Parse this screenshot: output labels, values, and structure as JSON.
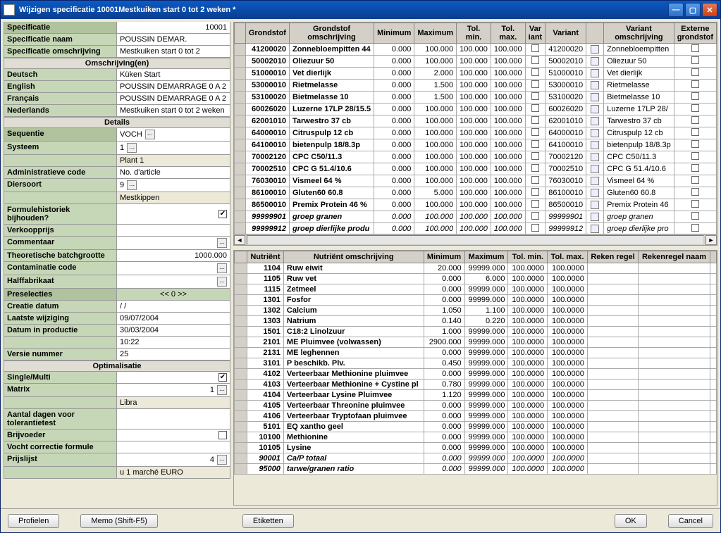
{
  "title": "Wijzigen specificatie       10001Mestkuiken start 0 tot 2 weken       *",
  "left": {
    "spec": {
      "specificatie_l": "Specificatie",
      "specificatie_v": "10001",
      "specnaam_l": "Specificatie naam",
      "specnaam_v": "POUSSIN DEMAR.",
      "specoms_l": "Specificatie omschrijving",
      "specoms_v": "Mestkuiken start 0 tot 2"
    },
    "oms_hdr": "Omschrijving(en)",
    "langs": [
      {
        "l": "Deutsch",
        "v": "Küken Start"
      },
      {
        "l": "English",
        "v": "POUSSIN DEMARRAGE 0 A 2"
      },
      {
        "l": "Français",
        "v": "POUSSIN DEMARRAGE 0 A 2"
      },
      {
        "l": "Nederlands",
        "v": "Mestkuiken start 0 tot 2 weken"
      }
    ],
    "details_hdr": "Details",
    "seq_l": "Sequentie",
    "seq_v": "VOCH",
    "sys_l": "Systeem",
    "sys_v": "1",
    "sys_v2": "Plant 1",
    "admin_l": "Administratieve code",
    "admin_v": "No. d'article",
    "dier_l": "Diersoort",
    "dier_v": "9",
    "dier_v2": "Mestkippen",
    "hist_l": "Formulehistoriek bijhouden?",
    "verkoop_l": "Verkoopprijs",
    "comm_l": "Commentaar",
    "batch_l": "Theoretische batchgrootte",
    "batch_v": "1000.000",
    "cont_l": "Contaminatie code",
    "half_l": "Halffabrikaat",
    "presel_l": "Preselecties",
    "presel_v": "<<   0   >>",
    "cdat_l": "Creatie datum",
    "cdat_v": "/ /",
    "lwijz_l": "Laatste wijziging",
    "lwijz_v": "09/07/2004",
    "dprod_l": "Datum in productie",
    "dprod_v": "30/03/2004",
    "dprod_v2": "10:22",
    "vers_l": "Versie nummer",
    "vers_v": "25",
    "opt_hdr": "Optimalisatie",
    "sm_l": "Single/Multi",
    "matrix_l": "Matrix",
    "matrix_v": "1",
    "matrix_v2": "Libra",
    "adag_l": "Aantal dagen voor tolerantietest",
    "brij_l": "Brijvoeder",
    "vocht_l": "Vocht correctie formule",
    "prijs_l": "Prijslijst",
    "prijs_v": "4",
    "prijs_v2": "u 1 marché EURO"
  },
  "top_headers": [
    "Grondstof",
    "Grondstof omschrijving",
    "Minimum",
    "Maximum",
    "Tol. min.",
    "Tol. max.",
    "Var iant",
    "Variant",
    "",
    "Variant omschrijving",
    "Externe grondstof"
  ],
  "top_rows": [
    {
      "g": "41200020",
      "o": "Zonnebloempitten 44",
      "mn": "0.000",
      "mx": "100.000",
      "tn": "100.000",
      "tx": "100.000",
      "v": "41200020",
      "vo": "Zonnebloempitten"
    },
    {
      "g": "50002010",
      "o": "Oliezuur 50",
      "mn": "0.000",
      "mx": "100.000",
      "tn": "100.000",
      "tx": "100.000",
      "v": "50002010",
      "vo": "Oliezuur 50"
    },
    {
      "g": "51000010",
      "o": "Vet dierlijk",
      "mn": "0.000",
      "mx": "2.000",
      "tn": "100.000",
      "tx": "100.000",
      "v": "51000010",
      "vo": "Vet dierlijk"
    },
    {
      "g": "53000010",
      "o": "Rietmelasse",
      "mn": "0.000",
      "mx": "1.500",
      "tn": "100.000",
      "tx": "100.000",
      "v": "53000010",
      "vo": "Rietmelasse"
    },
    {
      "g": "53100020",
      "o": "Bietmelasse 10",
      "mn": "0.000",
      "mx": "1.500",
      "tn": "100.000",
      "tx": "100.000",
      "v": "53100020",
      "vo": "Bietmelasse 10"
    },
    {
      "g": "60026020",
      "o": "Luzerne 17LP 28/15.5",
      "mn": "0.000",
      "mx": "100.000",
      "tn": "100.000",
      "tx": "100.000",
      "v": "60026020",
      "vo": "Luzerne 17LP 28/"
    },
    {
      "g": "62001010",
      "o": "Tarwestro 37 cb",
      "mn": "0.000",
      "mx": "100.000",
      "tn": "100.000",
      "tx": "100.000",
      "v": "62001010",
      "vo": "Tarwestro 37 cb"
    },
    {
      "g": "64000010",
      "o": "Citruspulp 12 cb",
      "mn": "0.000",
      "mx": "100.000",
      "tn": "100.000",
      "tx": "100.000",
      "v": "64000010",
      "vo": "Citruspulp 12 cb"
    },
    {
      "g": "64100010",
      "o": "bietenpulp 18/8.3p",
      "mn": "0.000",
      "mx": "100.000",
      "tn": "100.000",
      "tx": "100.000",
      "v": "64100010",
      "vo": "bietenpulp 18/8.3p"
    },
    {
      "g": "70002120",
      "o": "CPC C50/11.3",
      "mn": "0.000",
      "mx": "100.000",
      "tn": "100.000",
      "tx": "100.000",
      "v": "70002120",
      "vo": "CPC C50/11.3"
    },
    {
      "g": "70002510",
      "o": "CPC G 51.4/10.6",
      "mn": "0.000",
      "mx": "100.000",
      "tn": "100.000",
      "tx": "100.000",
      "v": "70002510",
      "vo": "CPC G 51.4/10.6"
    },
    {
      "g": "76030010",
      "o": "Vismeel 64 %",
      "mn": "0.000",
      "mx": "100.000",
      "tn": "100.000",
      "tx": "100.000",
      "v": "76030010",
      "vo": "Vismeel 64 %"
    },
    {
      "g": "86100010",
      "o": "Gluten60 60.8",
      "mn": "0.000",
      "mx": "5.000",
      "tn": "100.000",
      "tx": "100.000",
      "v": "86100010",
      "vo": "Gluten60 60.8"
    },
    {
      "g": "86500010",
      "o": "Premix Protein 46 %",
      "mn": "0.000",
      "mx": "100.000",
      "tn": "100.000",
      "tx": "100.000",
      "v": "86500010",
      "vo": "Premix Protein 46"
    },
    {
      "g": "99999901",
      "o": "groep granen",
      "mn": "0.000",
      "mx": "100.000",
      "tn": "100.000",
      "tx": "100.000",
      "v": "99999901",
      "vo": "groep granen",
      "it": true
    },
    {
      "g": "99999912",
      "o": "groep dierlijke produ",
      "mn": "0.000",
      "mx": "100.000",
      "tn": "100.000",
      "tx": "100.000",
      "v": "99999912",
      "vo": "groep dierlijke pro",
      "it": true
    }
  ],
  "bot_headers": [
    "Nutriënt",
    "Nutriënt omschrijving",
    "Minimum",
    "Maximum",
    "Tol. min.",
    "Tol. max.",
    "Reken regel",
    "Rekenregel naam",
    ""
  ],
  "bot_rows": [
    {
      "n": "1104",
      "o": "Ruw eiwit",
      "mn": "20.000",
      "mx": "99999.000",
      "tn": "100.0000",
      "tx": "100.0000"
    },
    {
      "n": "1105",
      "o": "Ruw vet",
      "mn": "0.000",
      "mx": "6.000",
      "tn": "100.0000",
      "tx": "100.0000"
    },
    {
      "n": "1115",
      "o": "Zetmeel",
      "mn": "0.000",
      "mx": "99999.000",
      "tn": "100.0000",
      "tx": "100.0000"
    },
    {
      "n": "1301",
      "o": "Fosfor",
      "mn": "0.000",
      "mx": "99999.000",
      "tn": "100.0000",
      "tx": "100.0000"
    },
    {
      "n": "1302",
      "o": "Calcium",
      "mn": "1.050",
      "mx": "1.100",
      "tn": "100.0000",
      "tx": "100.0000"
    },
    {
      "n": "1303",
      "o": "Natrium",
      "mn": "0.140",
      "mx": "0.220",
      "tn": "100.0000",
      "tx": "100.0000"
    },
    {
      "n": "1501",
      "o": "C18:2 Linolzuur",
      "mn": "1.000",
      "mx": "99999.000",
      "tn": "100.0000",
      "tx": "100.0000"
    },
    {
      "n": "2101",
      "o": "ME Pluimvee (volwassen)",
      "mn": "2900.000",
      "mx": "99999.000",
      "tn": "100.0000",
      "tx": "100.0000"
    },
    {
      "n": "2131",
      "o": "ME leghennen",
      "mn": "0.000",
      "mx": "99999.000",
      "tn": "100.0000",
      "tx": "100.0000"
    },
    {
      "n": "3101",
      "o": "P beschikb. Plv.",
      "mn": "0.450",
      "mx": "99999.000",
      "tn": "100.0000",
      "tx": "100.0000"
    },
    {
      "n": "4102",
      "o": "Verteerbaar Methionine pluimvee",
      "mn": "0.000",
      "mx": "99999.000",
      "tn": "100.0000",
      "tx": "100.0000"
    },
    {
      "n": "4103",
      "o": "Verteerbaar Methionine + Cystine pl",
      "mn": "0.780",
      "mx": "99999.000",
      "tn": "100.0000",
      "tx": "100.0000"
    },
    {
      "n": "4104",
      "o": "Verteerbaar Lysine Pluimvee",
      "mn": "1.120",
      "mx": "99999.000",
      "tn": "100.0000",
      "tx": "100.0000"
    },
    {
      "n": "4105",
      "o": "Verteerbaar Threonine pluimvee",
      "mn": "0.000",
      "mx": "99999.000",
      "tn": "100.0000",
      "tx": "100.0000"
    },
    {
      "n": "4106",
      "o": "Verteerbaar Tryptofaan pluimvee",
      "mn": "0.000",
      "mx": "99999.000",
      "tn": "100.0000",
      "tx": "100.0000"
    },
    {
      "n": "5101",
      "o": "EQ xantho geel",
      "mn": "0.000",
      "mx": "99999.000",
      "tn": "100.0000",
      "tx": "100.0000"
    },
    {
      "n": "10100",
      "o": "Methionine",
      "mn": "0.000",
      "mx": "99999.000",
      "tn": "100.0000",
      "tx": "100.0000"
    },
    {
      "n": "10105",
      "o": "Lysine",
      "mn": "0.000",
      "mx": "99999.000",
      "tn": "100.0000",
      "tx": "100.0000"
    },
    {
      "n": "90001",
      "o": "Ca/P totaal",
      "mn": "0.000",
      "mx": "99999.000",
      "tn": "100.0000",
      "tx": "100.0000",
      "it": true
    },
    {
      "n": "95000",
      "o": "tarwe/granen ratio",
      "mn": "0.000",
      "mx": "99999.000",
      "tn": "100.0000",
      "tx": "100.0000",
      "it": true
    }
  ],
  "footer": {
    "profielen": "Profielen",
    "memo": "Memo (Shift-F5)",
    "etiketten": "Etiketten",
    "ok": "OK",
    "cancel": "Cancel"
  }
}
